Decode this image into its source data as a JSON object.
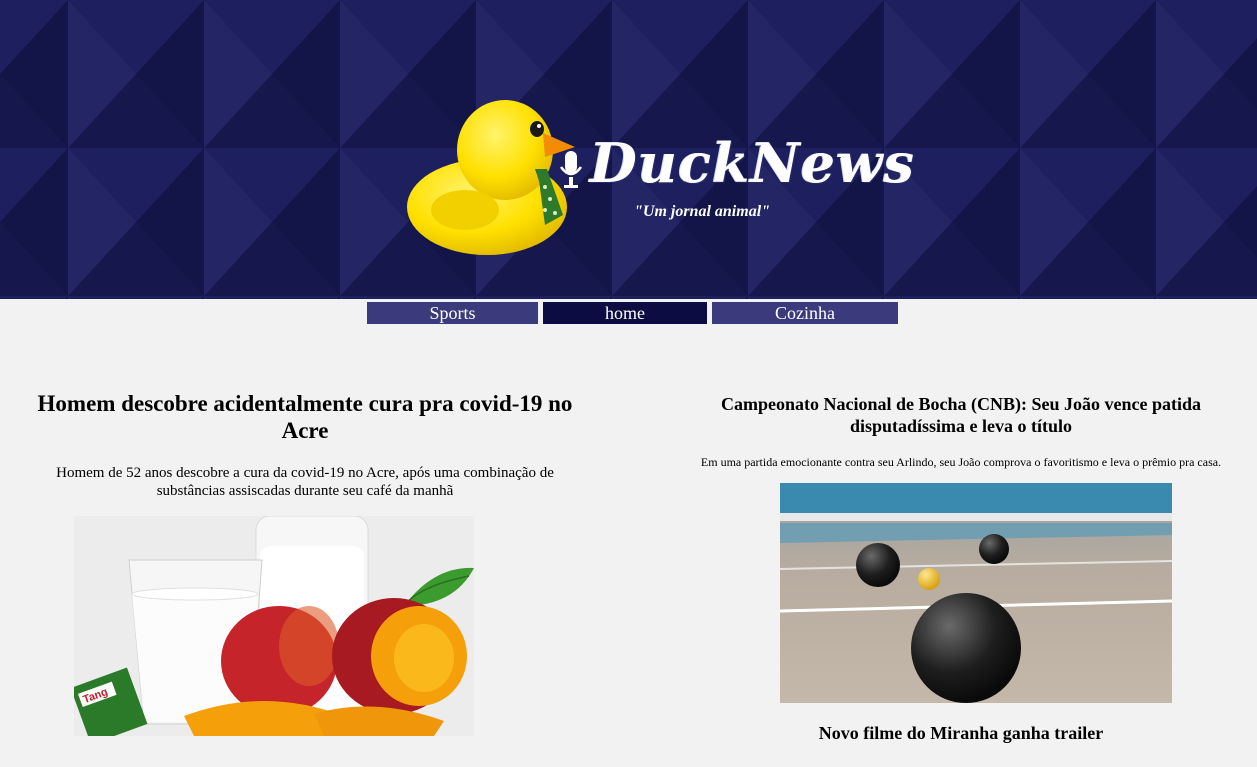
{
  "header": {
    "brand": "DuckNews",
    "tagline": "\"Um jornal animal\""
  },
  "nav": {
    "items": [
      {
        "label": "Sports"
      },
      {
        "label": "home"
      },
      {
        "label": "Cozinha"
      }
    ]
  },
  "articles": [
    {
      "title": "Homem descobre acidentalmente cura pra covid-19 no Acre",
      "summary": "Homem de 52 anos descobre a cura da covid-19 no Acre, após uma combinação de substâncias assiscadas durante seu café da manhã",
      "image_label": "Tang"
    },
    {
      "title": "Campeonato Nacional de Bocha (CNB): Seu João vence patida disputadíssima e leva o título",
      "summary": "Em uma partida emocionante contra seu Arlindo, seu João comprova o favoritismo e leva o prêmio pra casa."
    },
    {
      "title": "Novo filme do Miranha ganha trailer"
    }
  ],
  "colors": {
    "header_bg": "#1b1d5a",
    "nav_bg": "#3a3a7c",
    "nav_active_bg": "#0c0c42",
    "page_bg": "#f2f2f2"
  }
}
